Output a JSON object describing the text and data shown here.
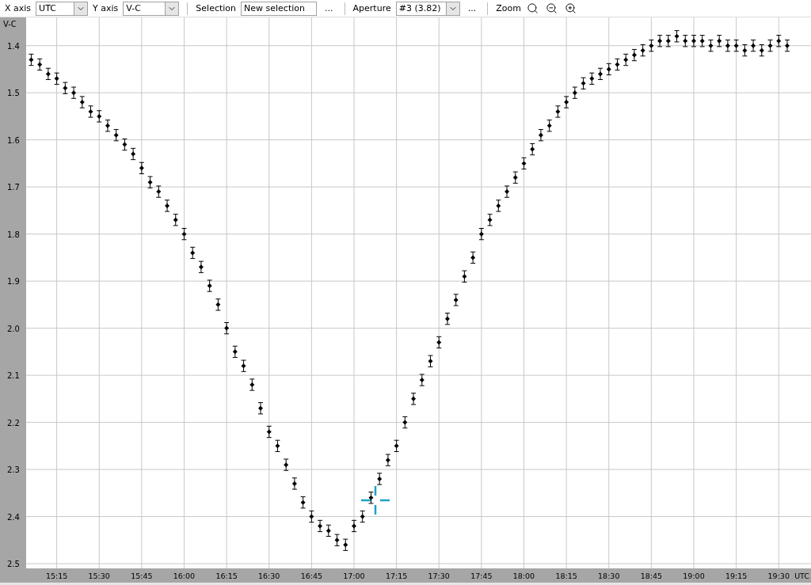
{
  "toolbar": {
    "x_axis": {
      "label": "X axis",
      "value": "UTC"
    },
    "y_axis": {
      "label": "Y axis",
      "value": "V-C"
    },
    "selection": {
      "label": "Selection",
      "value": "New selection",
      "more": "..."
    },
    "aperture": {
      "label": "Aperture",
      "value": "#3 (3.82)",
      "more": "..."
    },
    "zoom": {
      "label": "Zoom"
    }
  },
  "chart_data": {
    "type": "scatter",
    "xlabel": "UTC",
    "ylabel": "V-C",
    "grid": true,
    "xlim": [
      15.07,
      19.69
    ],
    "ylim": [
      2.51,
      1.34
    ],
    "xticks": [
      {
        "value": 15.25,
        "label": "15:15"
      },
      {
        "value": 15.5,
        "label": "15:30"
      },
      {
        "value": 15.75,
        "label": "15:45"
      },
      {
        "value": 16,
        "label": "16:00"
      },
      {
        "value": 16.25,
        "label": "16:15"
      },
      {
        "value": 16.5,
        "label": "16:30"
      },
      {
        "value": 16.75,
        "label": "16:45"
      },
      {
        "value": 17,
        "label": "17:00"
      },
      {
        "value": 17.25,
        "label": "17:15"
      },
      {
        "value": 17.5,
        "label": "17:30"
      },
      {
        "value": 17.75,
        "label": "17:45"
      },
      {
        "value": 18,
        "label": "18:00"
      },
      {
        "value": 18.25,
        "label": "18:15"
      },
      {
        "value": 18.5,
        "label": "18:30"
      },
      {
        "value": 18.75,
        "label": "18:45"
      },
      {
        "value": 19,
        "label": "19:00"
      },
      {
        "value": 19.25,
        "label": "19:15"
      },
      {
        "value": 19.5,
        "label": "19:30"
      }
    ],
    "yticks": [
      {
        "value": 1.4,
        "label": "1.4"
      },
      {
        "value": 1.5,
        "label": "1.5"
      },
      {
        "value": 1.6,
        "label": "1.6"
      },
      {
        "value": 1.7,
        "label": "1.7"
      },
      {
        "value": 1.8,
        "label": "1.8"
      },
      {
        "value": 1.9,
        "label": "1.9"
      },
      {
        "value": 2.0,
        "label": "2.0"
      },
      {
        "value": 2.1,
        "label": "2.1"
      },
      {
        "value": 2.2,
        "label": "2.2"
      },
      {
        "value": 2.3,
        "label": "2.3"
      },
      {
        "value": 2.4,
        "label": "2.4"
      },
      {
        "value": 2.5,
        "label": "2.5"
      }
    ],
    "x": [
      15.1,
      15.15,
      15.2,
      15.25,
      15.3,
      15.35,
      15.4,
      15.45,
      15.5,
      15.55,
      15.6,
      15.65,
      15.7,
      15.75,
      15.8,
      15.85,
      15.9,
      15.95,
      16.0,
      16.05,
      16.1,
      16.15,
      16.2,
      16.25,
      16.3,
      16.35,
      16.4,
      16.45,
      16.5,
      16.55,
      16.6,
      16.65,
      16.7,
      16.75,
      16.8,
      16.85,
      16.9,
      16.95,
      17.0,
      17.05,
      17.1,
      17.15,
      17.2,
      17.25,
      17.3,
      17.35,
      17.4,
      17.45,
      17.5,
      17.55,
      17.6,
      17.65,
      17.7,
      17.75,
      17.8,
      17.85,
      17.9,
      17.95,
      18.0,
      18.05,
      18.1,
      18.15,
      18.2,
      18.25,
      18.3,
      18.35,
      18.4,
      18.45,
      18.5,
      18.55,
      18.6,
      18.65,
      18.7,
      18.75,
      18.8,
      18.85,
      18.9,
      18.95,
      19.0,
      19.05,
      19.1,
      19.15,
      19.2,
      19.25,
      19.3,
      19.35,
      19.4,
      19.45,
      19.5,
      19.55
    ],
    "series": [
      {
        "color": "#000000",
        "errors": [
          0.012,
          0.012,
          0.012,
          0.012,
          0.012,
          0.012,
          0.012,
          0.012,
          0.012,
          0.012,
          0.012,
          0.012,
          0.012,
          0.012,
          0.012,
          0.012,
          0.012,
          0.012,
          0.012,
          0.012,
          0.012,
          0.012,
          0.012,
          0.012,
          0.012,
          0.012,
          0.012,
          0.012,
          0.012,
          0.012,
          0.012,
          0.012,
          0.012,
          0.012,
          0.012,
          0.012,
          0.012,
          0.012,
          0.012,
          0.012,
          0.012,
          0.012,
          0.012,
          0.012,
          0.012,
          0.012,
          0.012,
          0.012,
          0.012,
          0.012,
          0.012,
          0.012,
          0.012,
          0.012,
          0.012,
          0.012,
          0.012,
          0.012,
          0.012,
          0.012,
          0.012,
          0.012,
          0.012,
          0.012,
          0.012,
          0.012,
          0.012,
          0.012,
          0.012,
          0.012,
          0.012,
          0.012,
          0.012,
          0.012,
          0.012,
          0.012,
          0.012,
          0.012,
          0.012,
          0.012,
          0.012,
          0.012,
          0.012,
          0.012,
          0.012,
          0.012,
          0.012,
          0.012,
          0.012,
          0.012
        ],
        "values": [
          1.43,
          1.44,
          1.46,
          1.47,
          1.49,
          1.5,
          1.52,
          1.54,
          1.55,
          1.57,
          1.59,
          1.61,
          1.63,
          1.66,
          1.69,
          1.71,
          1.74,
          1.77,
          1.8,
          1.84,
          1.87,
          1.91,
          1.95,
          2.0,
          2.05,
          2.08,
          2.12,
          2.17,
          2.22,
          2.25,
          2.29,
          2.33,
          2.37,
          2.4,
          2.42,
          2.43,
          2.45,
          2.46,
          2.42,
          2.4,
          2.36,
          2.32,
          2.28,
          2.25,
          2.2,
          2.15,
          2.11,
          2.07,
          2.03,
          1.98,
          1.94,
          1.89,
          1.85,
          1.8,
          1.77,
          1.74,
          1.71,
          1.68,
          1.65,
          1.62,
          1.59,
          1.57,
          1.54,
          1.52,
          1.5,
          1.48,
          1.47,
          1.46,
          1.45,
          1.44,
          1.43,
          1.42,
          1.41,
          1.4,
          1.39,
          1.39,
          1.38,
          1.39,
          1.39,
          1.39,
          1.4,
          1.39,
          1.4,
          1.4,
          1.41,
          1.4,
          1.41,
          1.4,
          1.39,
          1.4
        ]
      }
    ]
  }
}
